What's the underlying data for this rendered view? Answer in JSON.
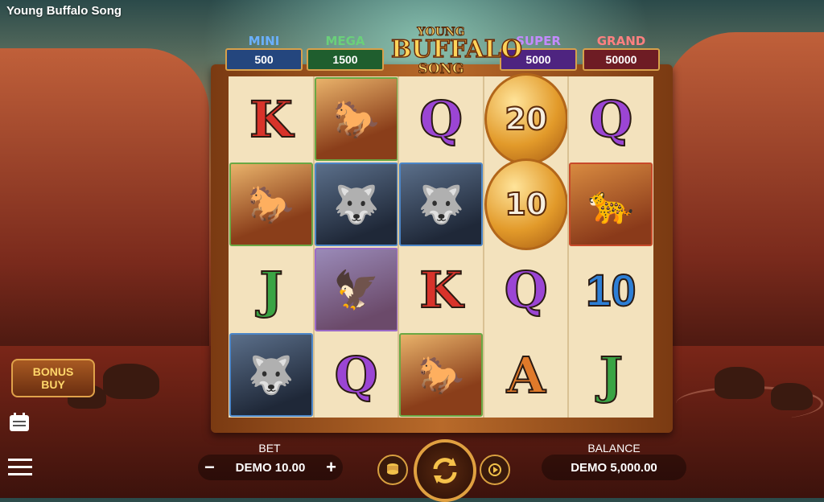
{
  "app": {
    "title": "Young Buffalo Song"
  },
  "logo": {
    "line1": "YOUNG",
    "line2": "BUFFALO",
    "line3": "SONG"
  },
  "jackpots": [
    {
      "name": "MINI",
      "value": "500",
      "color": "#2f6fd0"
    },
    {
      "name": "MEGA",
      "value": "1500",
      "color": "#2fa04a"
    },
    {
      "name": "SUPER",
      "value": "5000",
      "color": "#8a3ad0"
    },
    {
      "name": "GRAND",
      "value": "50000",
      "color": "#c0303a"
    }
  ],
  "reels": [
    [
      {
        "type": "letter",
        "text": "K",
        "cls": "k"
      },
      {
        "type": "animal",
        "animal": "horse"
      },
      {
        "type": "letter",
        "text": "J",
        "cls": "j"
      },
      {
        "type": "animal",
        "animal": "wolf"
      }
    ],
    [
      {
        "type": "animal",
        "animal": "horse"
      },
      {
        "type": "animal",
        "animal": "wolf"
      },
      {
        "type": "animal",
        "animal": "eagle"
      },
      {
        "type": "letter",
        "text": "Q",
        "cls": "q"
      }
    ],
    [
      {
        "type": "letter",
        "text": "Q",
        "cls": "q"
      },
      {
        "type": "animal",
        "animal": "wolf"
      },
      {
        "type": "letter",
        "text": "K",
        "cls": "k"
      },
      {
        "type": "animal",
        "animal": "horse"
      }
    ],
    [
      {
        "type": "coin",
        "text": "20"
      },
      {
        "type": "coin",
        "text": "10"
      },
      {
        "type": "letter",
        "text": "Q",
        "cls": "q"
      },
      {
        "type": "letter",
        "text": "A",
        "cls": "a"
      }
    ],
    [
      {
        "type": "letter",
        "text": "Q",
        "cls": "q"
      },
      {
        "type": "animal",
        "animal": "cougar"
      },
      {
        "type": "letter",
        "text": "10",
        "cls": "ten"
      },
      {
        "type": "letter",
        "text": "J",
        "cls": "j"
      }
    ]
  ],
  "bonus_buy": {
    "line1": "BONUS",
    "line2": "BUY"
  },
  "bet": {
    "label": "BET",
    "value": "DEMO 10.00",
    "minus": "−",
    "plus": "+"
  },
  "balance": {
    "label": "BALANCE",
    "value": "DEMO 5,000.00"
  },
  "icons": {
    "menu": "menu-icon",
    "history": "history-icon",
    "spin": "spin-icon",
    "autoplay": "autoplay-icon",
    "coins": "coin-stack-icon"
  }
}
